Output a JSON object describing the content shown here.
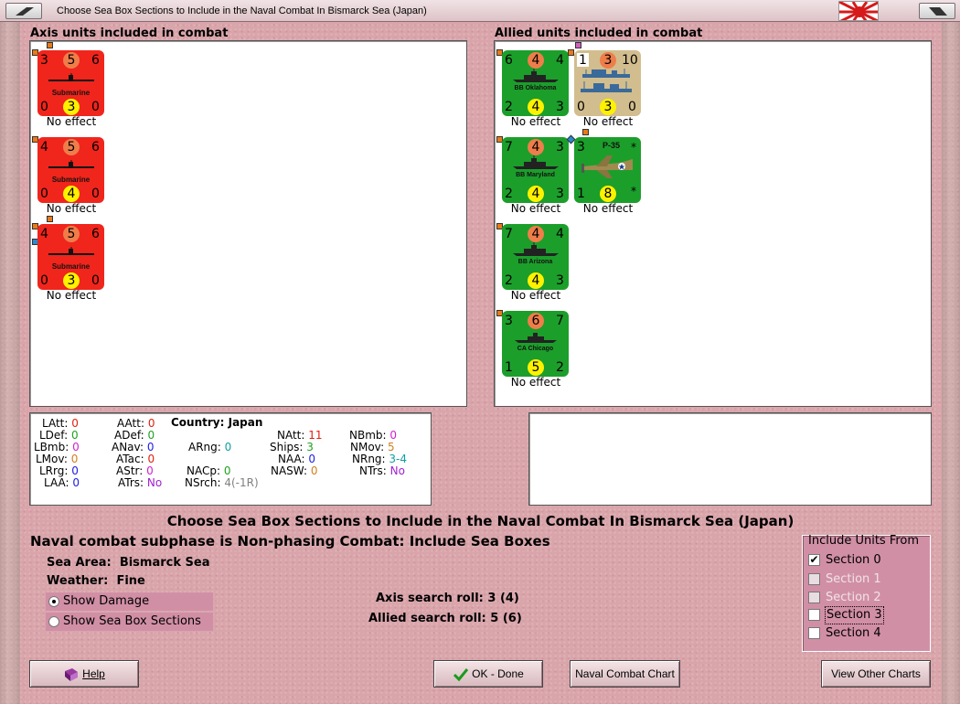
{
  "window": {
    "title": "Choose Sea Box Sections to Include in the Naval Combat In Bismarck Sea (Japan)"
  },
  "axis": {
    "header": "Axis units included in combat",
    "units": [
      {
        "name": "Submarine",
        "tl": "3",
        "tc": "5",
        "tr": "6",
        "bl": "0",
        "bc": "3",
        "br": "0",
        "caption": "No effect"
      },
      {
        "name": "Submarine",
        "tl": "4",
        "tc": "5",
        "tr": "6",
        "bl": "0",
        "bc": "4",
        "br": "0",
        "caption": "No effect"
      },
      {
        "name": "Submarine",
        "tl": "4",
        "tc": "5",
        "tr": "6",
        "bl": "0",
        "bc": "3",
        "br": "0",
        "caption": "No effect"
      }
    ]
  },
  "allied": {
    "header": "Allied units included in combat",
    "units": [
      {
        "name": "BB Oklahoma",
        "tl": "6",
        "tc": "4",
        "tr": "4",
        "bl": "2",
        "bc": "4",
        "br": "3",
        "caption": "No effect"
      },
      {
        "name": "",
        "tl": "1",
        "tc": "3",
        "tr": "10",
        "bl": "0",
        "bc": "3",
        "br": "0",
        "caption": "No effect"
      },
      {
        "name": "BB Maryland",
        "tl": "7",
        "tc": "4",
        "tr": "3",
        "bl": "2",
        "bc": "4",
        "br": "3",
        "caption": "No effect"
      },
      {
        "name": "P-35",
        "tl": "3",
        "tc": "",
        "tr": "*",
        "bl": "1",
        "bc": "8",
        "br": "*",
        "caption": "No effect"
      },
      {
        "name": "BB Arizona",
        "tl": "7",
        "tc": "4",
        "tr": "4",
        "bl": "2",
        "bc": "4",
        "br": "3",
        "caption": "No effect"
      },
      {
        "name": "CA Chicago",
        "tl": "3",
        "tc": "6",
        "tr": "7",
        "bl": "1",
        "bc": "5",
        "br": "2",
        "caption": "No effect"
      }
    ]
  },
  "stats": {
    "country_label": "Country:",
    "country": "Japan",
    "LAtt": "0",
    "LDef": "0",
    "LBmb": "0",
    "LMov": "0",
    "LRrg": "0",
    "LAA": "0",
    "AAtt": "0",
    "ADef": "0",
    "ANav": "0",
    "ATac": "0",
    "AStr": "0",
    "ATrs": "No",
    "ARng": "0",
    "NACp": "0",
    "NSrch": "4(-1R)",
    "NAtt": "11",
    "Ships": "3",
    "NAA": "0",
    "NASW": "0",
    "NBmb": "0",
    "NMov": "5",
    "NRng": "3-4",
    "NTrs": "No"
  },
  "main": {
    "heading": "Choose Sea Box Sections to Include in the Naval Combat In Bismarck Sea (Japan)",
    "subphase": "Naval combat subphase is Non-phasing Combat: Include Sea Boxes",
    "sea_area_label": "Sea Area:",
    "sea_area": "Bismarck Sea",
    "weather_label": "Weather:",
    "weather": "Fine",
    "axis_roll": "Axis search roll: 3 (4)",
    "allied_roll": "Allied search roll: 5 (6)"
  },
  "display": {
    "opt1": "Show Damage",
    "opt2": "Show Sea Box Sections",
    "selected": 1
  },
  "include": {
    "legend": "Include Units From",
    "sections": [
      {
        "label": "Section 0",
        "checked": true,
        "enabled": true
      },
      {
        "label": "Section 1",
        "checked": false,
        "enabled": false
      },
      {
        "label": "Section 2",
        "checked": false,
        "enabled": false
      },
      {
        "label": "Section 3",
        "checked": false,
        "enabled": true
      },
      {
        "label": "Section 4",
        "checked": false,
        "enabled": true
      }
    ]
  },
  "buttons": {
    "help": "Help",
    "ok": "OK - Done",
    "chart": "Naval Combat Chart",
    "other": "View Other Charts"
  },
  "colors": {
    "axis_unit": "#f0251c",
    "allied_unit": "#1c9e2b",
    "transport_unit": "#d2bd8e",
    "attack_circle": "#ef7d4a",
    "defense_circle": "#fff200",
    "accent": "#d18fa6"
  },
  "icons": {
    "help": "book-icon",
    "ok": "checkmark-icon",
    "flag": "rising-sun-flag-icon"
  }
}
